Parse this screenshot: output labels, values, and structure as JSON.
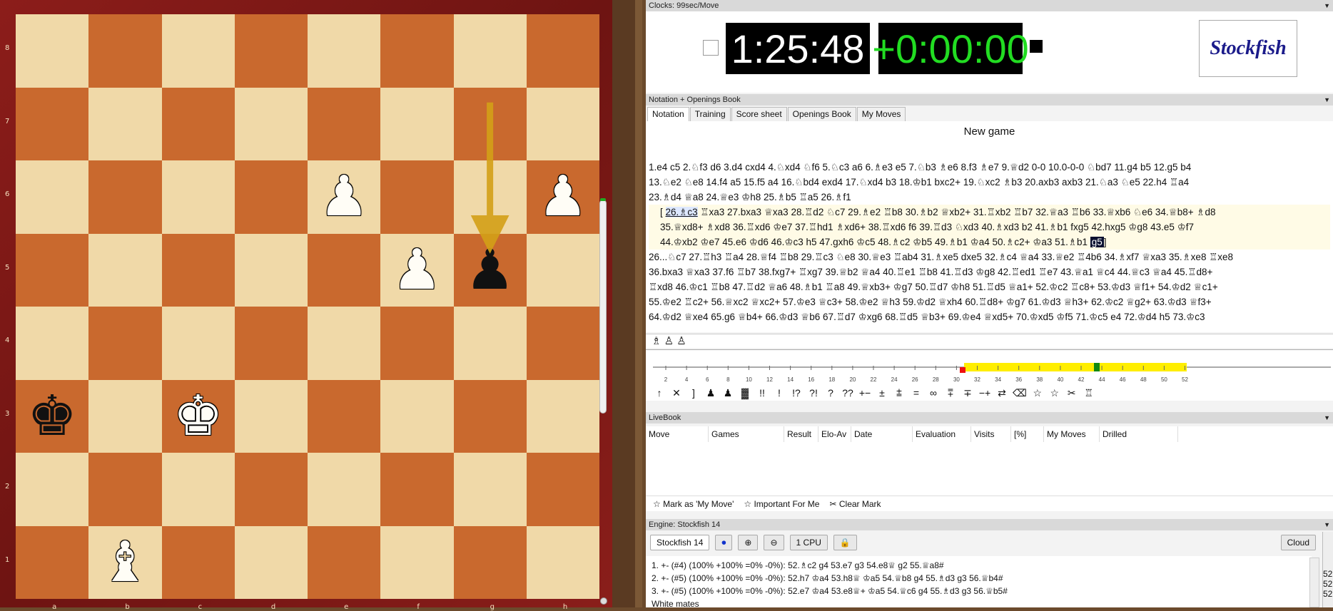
{
  "board": {
    "ranks": [
      "8",
      "7",
      "6",
      "5",
      "4",
      "3",
      "2",
      "1"
    ],
    "files": [
      "a",
      "b",
      "c",
      "d",
      "e",
      "f",
      "g",
      "h"
    ],
    "pieces": [
      {
        "square": "e6",
        "glyph": "♟",
        "color": "white",
        "name": "white-pawn"
      },
      {
        "square": "h6",
        "glyph": "♟",
        "color": "white",
        "name": "white-pawn"
      },
      {
        "square": "f5",
        "glyph": "♟",
        "color": "white",
        "name": "white-pawn"
      },
      {
        "square": "g5",
        "glyph": "♟",
        "color": "black",
        "name": "black-pawn"
      },
      {
        "square": "a3",
        "glyph": "♚",
        "color": "black",
        "name": "black-king"
      },
      {
        "square": "c3",
        "glyph": "♚",
        "color": "white",
        "name": "white-king"
      },
      {
        "square": "b1",
        "glyph": "♝",
        "color": "white",
        "name": "white-bishop"
      }
    ],
    "arrow": {
      "from": "g7",
      "to": "g5",
      "color": "#d4a017"
    }
  },
  "clocks": {
    "header": "Clocks: 99sec/Move",
    "white_time": "1:25:48",
    "black_time": "+0:00:00",
    "engine_name": "Stockfish",
    "black_time_color": "#22dd22"
  },
  "notation_panel": {
    "header": "Notation + Openings Book",
    "tabs": [
      "Notation",
      "Training",
      "Score sheet",
      "Openings Book",
      "My Moves"
    ],
    "game_title": "New game",
    "lines": [
      "1.e4  c5  2.♘f3  d6  3.d4  cxd4  4.♘xd4  ♘f6  5.♘c3  a6  6.♗e3  e5  7.♘b3  ♗e6  8.f3  ♗e7  9.♕d2  0-0  10.0-0-0  ♘bd7  11.g4  b5  12.g5  b4",
      "13.♘e2  ♘e8  14.f4  a5  15.f5  a4  16.♘bd4  exd4  17.♘xd4  b3  18.♔b1  bxc2+  19.♘xc2  ♗b3  20.axb3  axb3  21.♘a3  ♘e5  22.h4  ♖a4",
      "23.♗d4  ♕a8  24.♕e3  ♔h8  25.♗b5  ♖a5  26.♗f1"
    ],
    "variation_start": "26.♗c3",
    "variation_lines": [
      " ♖xa3  27.bxa3  ♕xa3  28.♖d2  ♘c7  29.♗e2  ♖b8  30.♗b2  ♕xb2+  31.♖xb2  ♖b7  32.♕a3  ♖b6  33.♕xb6  ♘e6  34.♕b8+  ♗d8",
      "35.♕xd8+  ♗xd8  36.♖xd6  ♔e7  37.♖hd1  ♗xd6+  38.♖xd6  f6  39.♖d3  ♘xd3  40.♗xd3  b2  41.♗b1  fxg5  42.hxg5  ♔g8  43.e5  ♔f7",
      "44.♔xb2  ♔e7  45.e6  ♔d6  46.♔c3  h5  47.gxh6  ♔c5  48.♗c2  ♔b5  49.♗b1  ♔a4  50.♗c2+  ♔a3  51.♗b1"
    ],
    "variation_current": "g5",
    "main_lines": [
      "26...♘c7  27.♖h3  ♖a4  28.♕f4  ♖b8  29.♖c3  ♘e8  30.♕e3  ♖ab4  31.♗xe5  dxe5  32.♗c4  ♕a4  33.♕e2  ♖4b6  34.♗xf7  ♕xa3  35.♗xe8  ♖xe8",
      "36.bxa3  ♕xa3  37.f6  ♖b7  38.fxg7+  ♖xg7  39.♕b2  ♕a4  40.♖e1  ♖b8  41.♖d3  ♔g8  42.♖ed1  ♖e7  43.♕a1  ♕c4  44.♕c3  ♕a4  45.♖d8+",
      "♖xd8  46.♔c1  ♖b8  47.♖d2  ♕a6  48.♗b1  ♖a8  49.♕xb3+  ♔g7  50.♖d7  ♔h8  51.♖d5  ♕a1+  52.♔c2  ♖c8+  53.♔d3  ♕f1+  54.♔d2  ♕c1+",
      "55.♔e2  ♖c2+  56.♕xc2  ♕xc2+  57.♔e3  ♕c3+  58.♔e2  ♕h3  59.♔d2  ♕xh4  60.♖d8+  ♔g7  61.♔d3  ♕h3+  62.♔c2  ♕g2+  63.♔d3  ♕f3+",
      "64.♔d2  ♕xe4  65.g6  ♕b4+  66.♔d3  ♕b6  67.♖d7  ♔xg6  68.♖d5  ♕b3+  69.♔e4  ♕xd5+  70.♔xd5  ♔f5  71.♔c5  e4  72.♔d4  h5  73.♔c3"
    ],
    "piece_icons": "♗ ♙ ♙"
  },
  "graph": {
    "ticks": [
      "2",
      "4",
      "6",
      "8",
      "10",
      "12",
      "14",
      "16",
      "18",
      "20",
      "22",
      "24",
      "26",
      "28",
      "30",
      "32",
      "34",
      "36",
      "38",
      "40",
      "42",
      "44",
      "46",
      "48",
      "50",
      "52"
    ]
  },
  "annotation_symbols": [
    "↑",
    "✕",
    "]",
    "♟",
    "♟",
    "▓",
    "!!",
    "!",
    "!?",
    "?!",
    "?",
    "??",
    "+−",
    "±",
    "⩲",
    "=",
    "∞",
    "⩱",
    "∓",
    "−+",
    "⇄",
    "⌫",
    "☆",
    "☆",
    "✂",
    "♖"
  ],
  "livebook": {
    "header": "LiveBook",
    "columns": [
      "Move",
      "Games",
      "Result",
      "Elo-Av",
      "Date",
      "Evaluation",
      "Visits",
      "[%]",
      "My Moves",
      "Drilled"
    ],
    "actions": [
      "Mark as 'My Move'",
      "Important For Me",
      "Clear Mark"
    ]
  },
  "engine": {
    "header": "Engine: Stockfish 14",
    "name": "Stockfish 14",
    "cpu": "1 CPU",
    "cloud": "Cloud",
    "lines": [
      "1. +- (#4) (100% +100% =0% -0%): 52.♗c2 g4 53.e7 g3 54.e8♕ g2 55.♕a8#",
      "2. +- (#5) (100% +100% =0% -0%): 52.h7 ♔a4 53.h8♕ ♔a5 54.♕b8 g4 55.♗d3 g3 56.♕b4#",
      "3. +- (#5) (100% +100% =0% -0%): 52.e7 ♔a4 53.e8♕+ ♔a5 54.♕c6 g4 55.♗d3 g3 56.♕b5#",
      "White mates"
    ],
    "side_numbers": [
      "52",
      "52",
      "52"
    ]
  }
}
